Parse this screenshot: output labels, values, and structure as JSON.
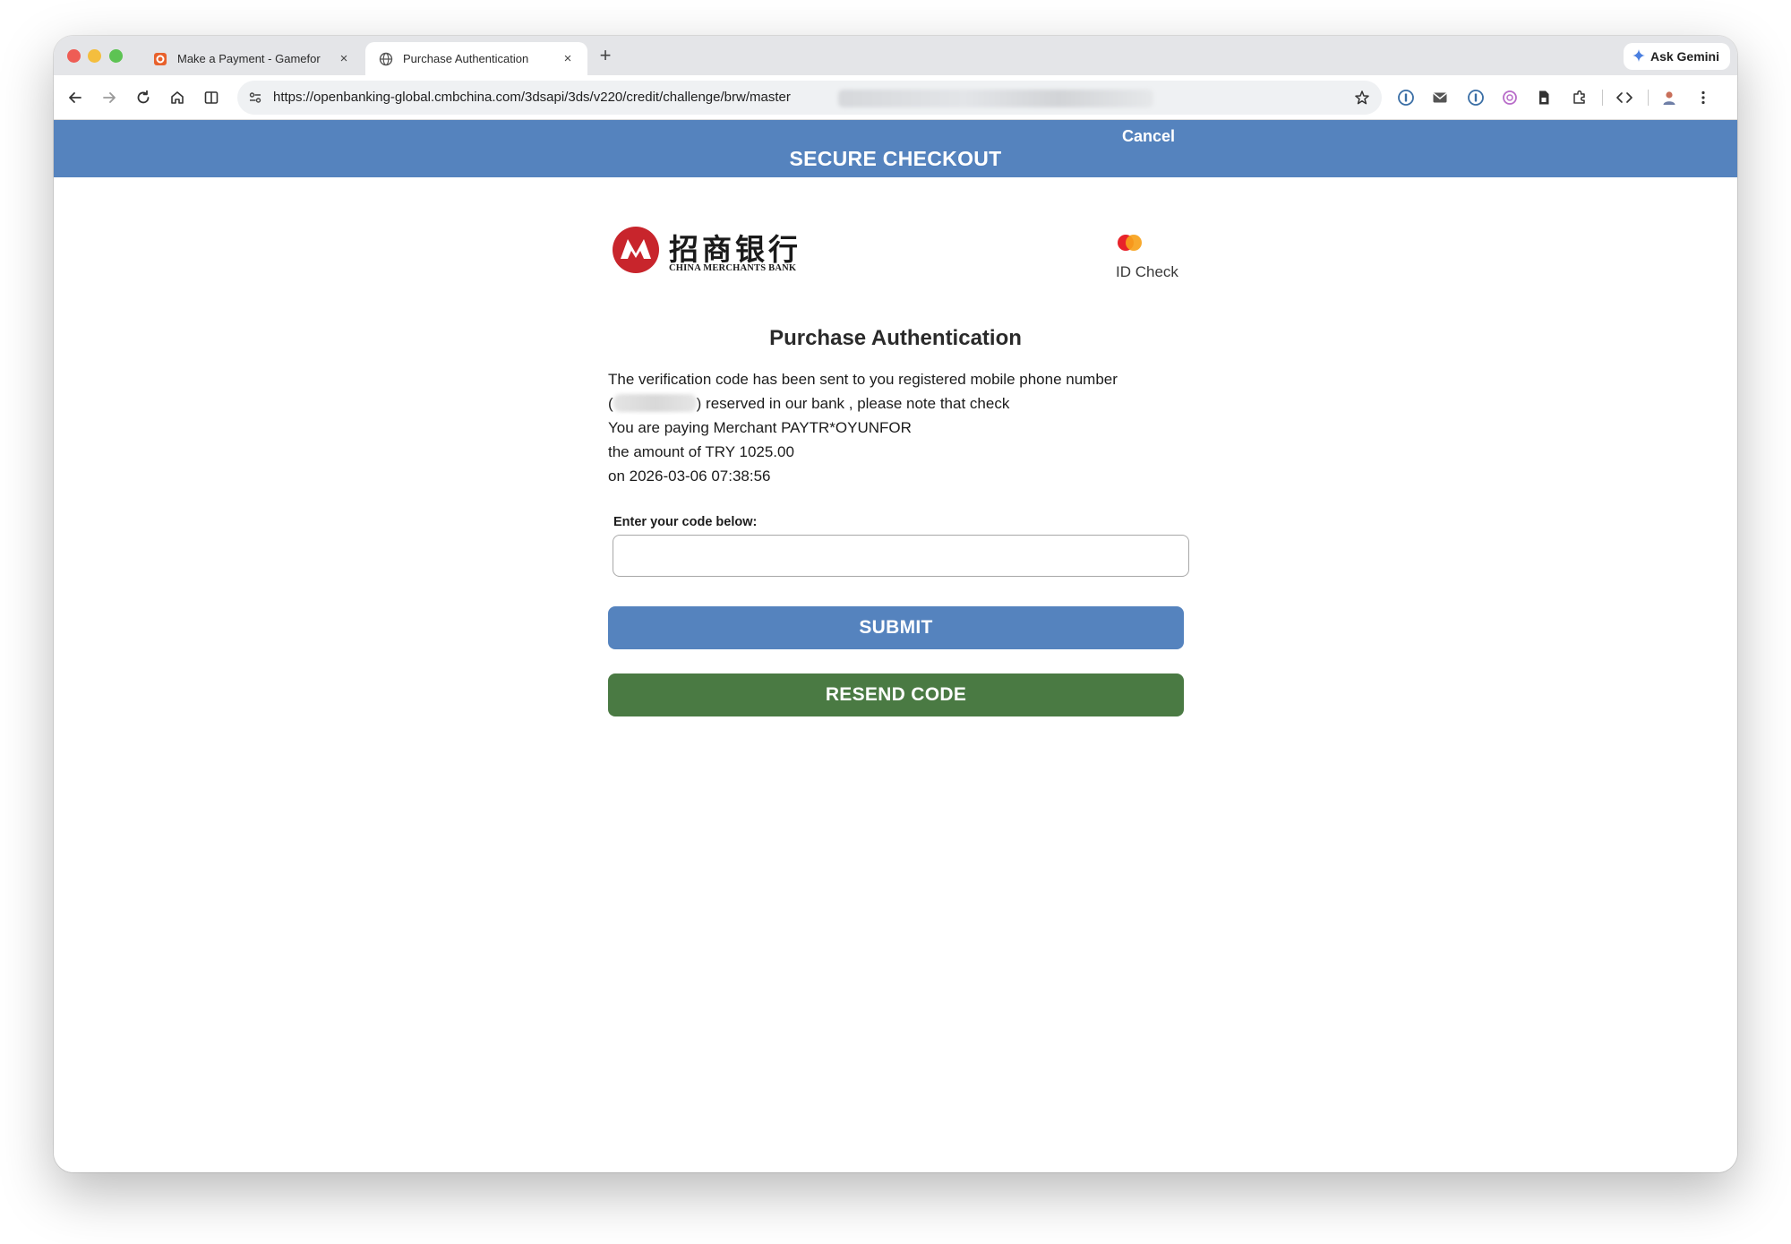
{
  "browser": {
    "tabs": [
      {
        "title": "Make a Payment - Gamefor",
        "active": false
      },
      {
        "title": "Purchase Authentication",
        "active": true
      }
    ],
    "new_tab_glyph": "+",
    "close_glyph": "×",
    "ask_gemini_label": "Ask Gemini",
    "url": "https://openbanking-global.cmbchina.com/3dsapi/3ds/v220/credit/challenge/brw/master"
  },
  "header": {
    "title": "SECURE CHECKOUT",
    "cancel_label": "Cancel",
    "color": "#5583be"
  },
  "bank": {
    "name_cn": "招商银行",
    "name_en": "CHINA MERCHANTS BANK",
    "logo_color": "#c8252c"
  },
  "scheme": {
    "label": "ID Check",
    "colors": [
      "#e8232a",
      "#f7a21b"
    ]
  },
  "auth": {
    "heading": "Purchase Authentication",
    "line1": "The verification code has been sent to you registered mobile phone number",
    "line2_open": "(",
    "line2_rest": ") reserved in our bank , please note that check",
    "line3": "You are paying Merchant PAYTR*OYUNFOR",
    "line4": "the amount of TRY 1025.00",
    "line5": "on 2026-03-06 07:38:56"
  },
  "form": {
    "code_label": "Enter your code below:",
    "code_value": "",
    "submit_label": "SUBMIT",
    "resend_label": "RESEND CODE",
    "submit_color": "#5583be",
    "resend_color": "#4a7a43"
  }
}
